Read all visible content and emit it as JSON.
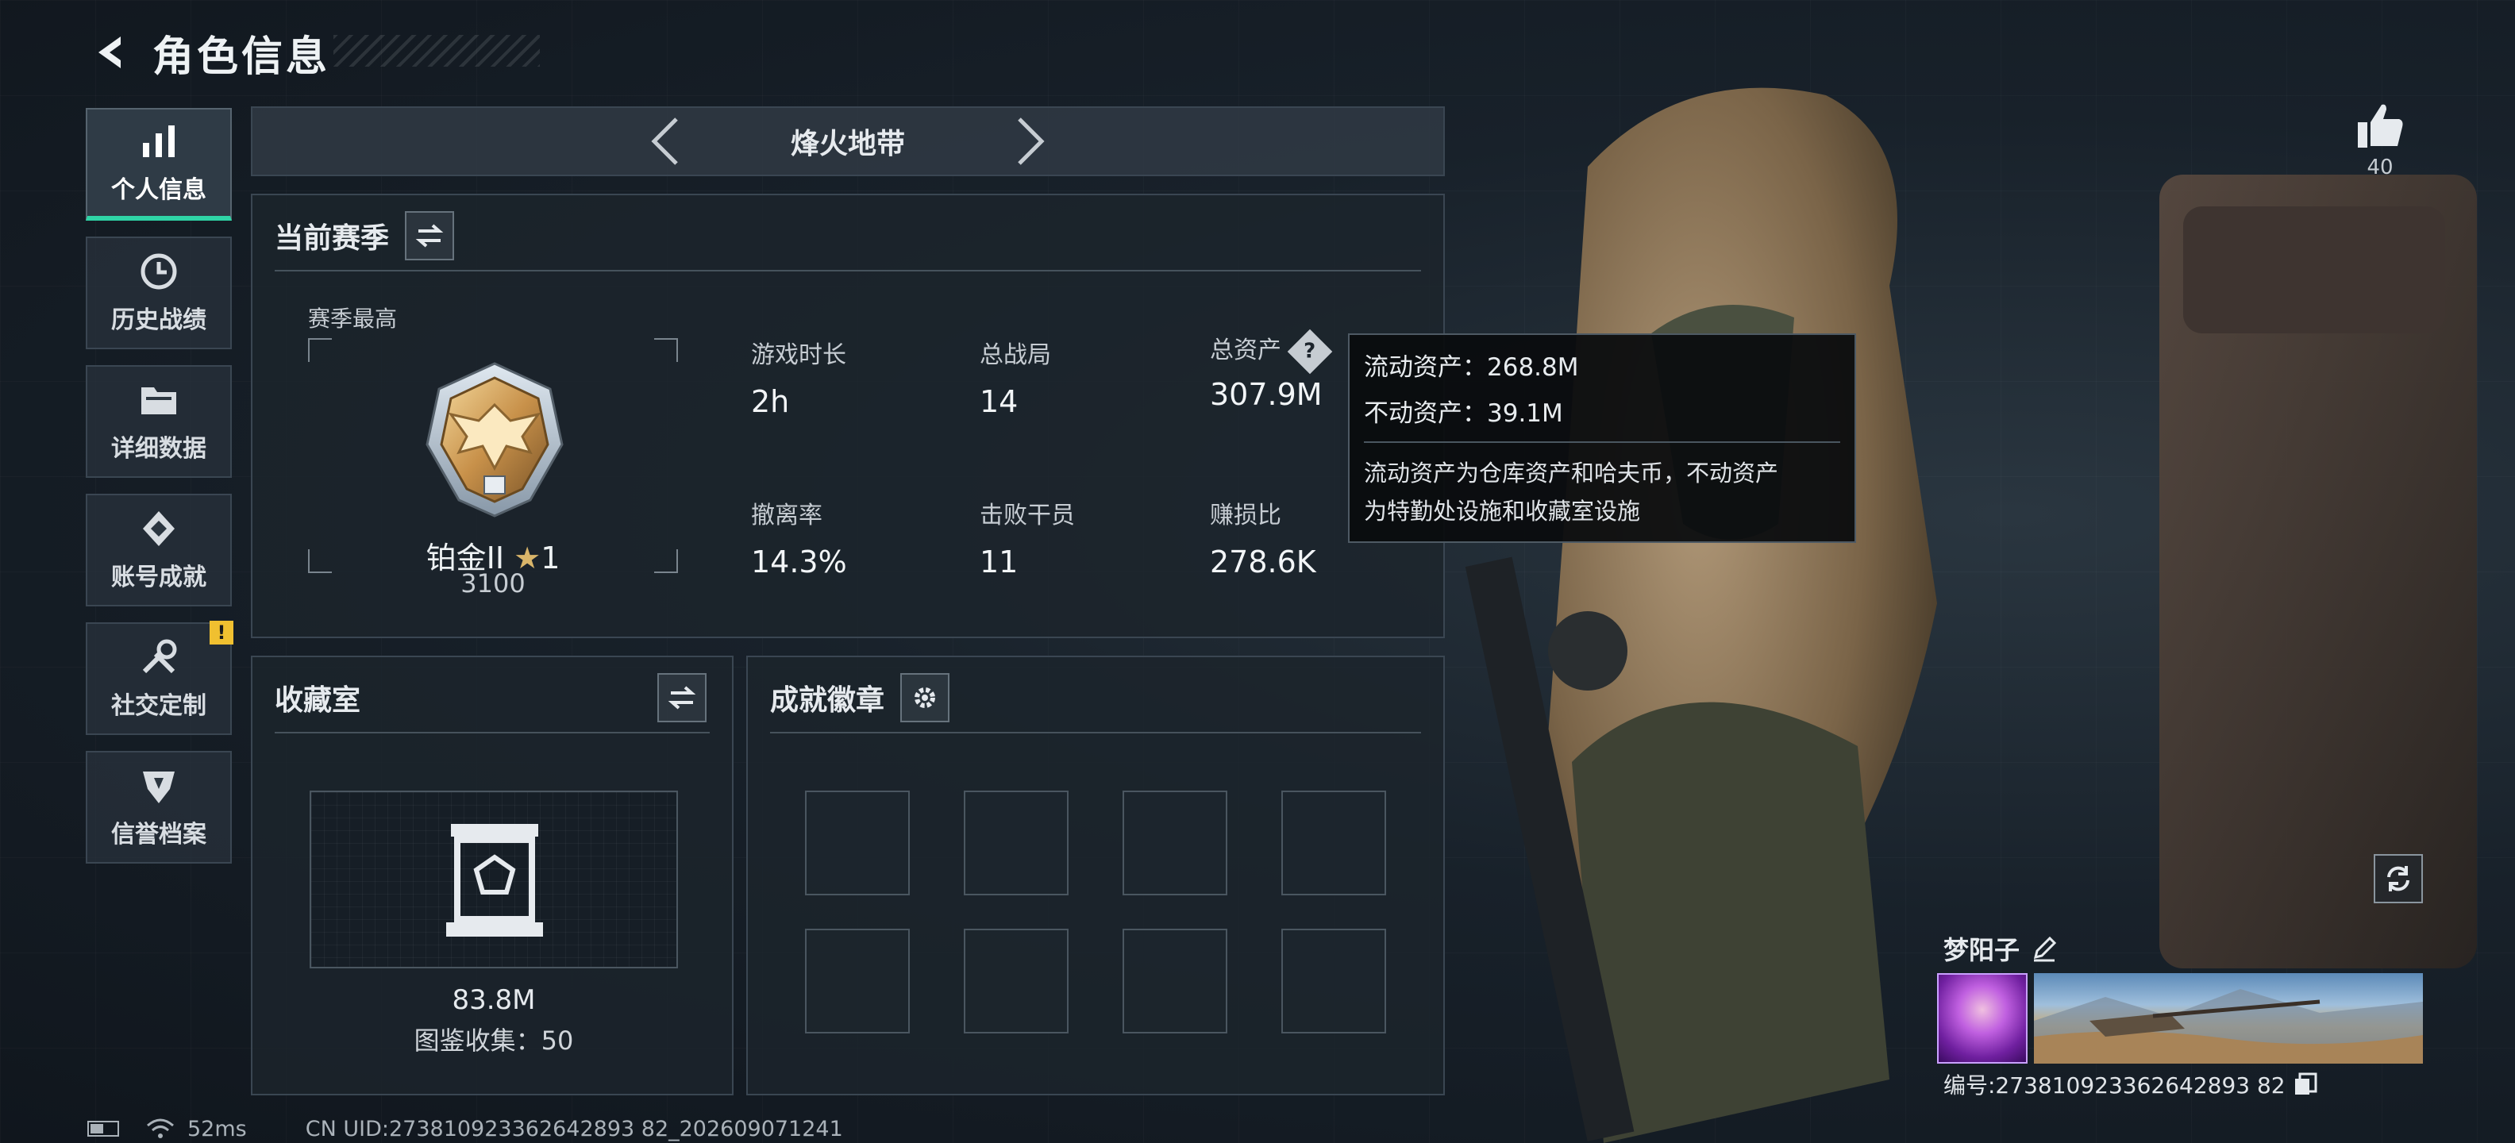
{
  "header": {
    "title": "角色信息"
  },
  "sidebar": {
    "items": [
      {
        "label": "个人信息",
        "icon": "bar-chart-icon",
        "active": true
      },
      {
        "label": "历史战绩",
        "icon": "history-icon"
      },
      {
        "label": "详细数据",
        "icon": "folder-icon"
      },
      {
        "label": "账号成就",
        "icon": "achievement-icon"
      },
      {
        "label": "社交定制",
        "icon": "tools-icon",
        "alert": "!"
      },
      {
        "label": "信誉档案",
        "icon": "reputation-icon"
      }
    ]
  },
  "mode": {
    "name": "烽火地带"
  },
  "season": {
    "title": "当前赛季",
    "best_label": "赛季最高",
    "rank_name": "铂金II",
    "rank_stars": "1",
    "rank_score": "3100",
    "stats": {
      "play_time": {
        "label": "游戏时长",
        "value": "2h"
      },
      "total_matches": {
        "label": "总战局",
        "value": "14"
      },
      "total_assets": {
        "label": "总资产",
        "value": "307.9M"
      },
      "extract_rate": {
        "label": "撤离率",
        "value": "14.3%"
      },
      "kills_operators": {
        "label": "击败干员",
        "value": "11"
      },
      "profit_ratio": {
        "label": "赚损比",
        "value": "278.6K"
      }
    }
  },
  "tooltip": {
    "liquid": "流动资产：268.8M",
    "fixed": "不动资产：39.1M",
    "desc_line1": "流动资产为仓库资产和哈夫币，不动资产",
    "desc_line2": "为特勤处设施和收藏室设施"
  },
  "collection": {
    "title": "收藏室",
    "value": "83.8M",
    "count": "图鉴收集：50"
  },
  "badges": {
    "title": "成就徽章"
  },
  "profile": {
    "likes": "40",
    "player_name": "梦阳子",
    "uid_text": "编号:273810923362642893 82"
  },
  "footer": {
    "ping": "52ms",
    "cn_uid": "CN UID:273810923362642893 82_202609071241"
  },
  "colors": {
    "accent": "#2fd4a6",
    "alert": "#f0c030"
  }
}
